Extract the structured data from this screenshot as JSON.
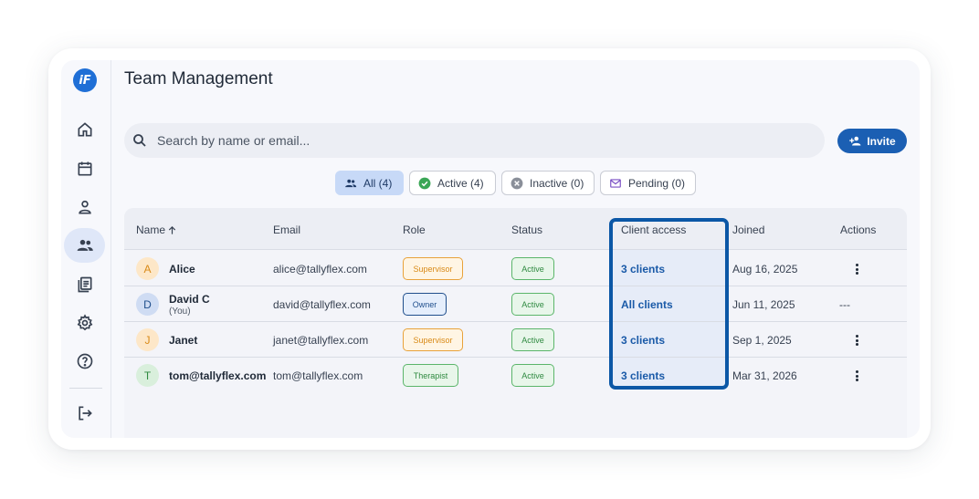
{
  "app": {
    "logo_text": "iF",
    "title": "Team Management"
  },
  "sidebar": {
    "items": [
      {
        "name": "home",
        "icon": "home-icon",
        "active": false
      },
      {
        "name": "calendar",
        "icon": "calendar-icon",
        "active": false
      },
      {
        "name": "person",
        "icon": "person-icon",
        "active": false
      },
      {
        "name": "team",
        "icon": "group-icon",
        "active": true
      },
      {
        "name": "notes",
        "icon": "notes-icon",
        "active": false
      },
      {
        "name": "settings",
        "icon": "gear-icon",
        "active": false
      },
      {
        "name": "help",
        "icon": "help-icon",
        "active": false
      },
      {
        "name": "logout",
        "icon": "logout-icon",
        "active": false
      }
    ]
  },
  "search": {
    "placeholder": "Search by name or email...",
    "value": ""
  },
  "invite": {
    "label": "Invite"
  },
  "filters": [
    {
      "label": "All (4)",
      "icon": "group-icon",
      "selected": true
    },
    {
      "label": "Active (4)",
      "icon": "check-circle-icon",
      "selected": false
    },
    {
      "label": "Inactive (0)",
      "icon": "x-circle-icon",
      "selected": false
    },
    {
      "label": "Pending (0)",
      "icon": "mail-icon",
      "selected": false
    }
  ],
  "table": {
    "headers": {
      "name": "Name",
      "email": "Email",
      "role": "Role",
      "status": "Status",
      "access": "Client access",
      "joined": "Joined",
      "actions": "Actions"
    },
    "rows": [
      {
        "initial": "A",
        "name": "Alice",
        "sub": "",
        "email": "alice@tallyflex.com",
        "role": "Supervisor",
        "status": "Active",
        "access": "3 clients",
        "joined": "Aug 16, 2025",
        "actions": ""
      },
      {
        "initial": "D",
        "name": "David C",
        "sub": "(You)",
        "email": "david@tallyflex.com",
        "role": "Owner",
        "status": "Active",
        "access": "All clients",
        "joined": "Jun 11, 2025",
        "actions": "---"
      },
      {
        "initial": "J",
        "name": "Janet",
        "sub": "",
        "email": "janet@tallyflex.com",
        "role": "Supervisor",
        "status": "Active",
        "access": "3 clients",
        "joined": "Sep 1, 2025",
        "actions": ""
      },
      {
        "initial": "T",
        "name": "tom@tallyflex.com",
        "sub": "",
        "email": "tom@tallyflex.com",
        "role": "Therapist",
        "status": "Active",
        "access": "3 clients",
        "joined": "Mar 31, 2026",
        "actions": ""
      }
    ]
  },
  "colors": {
    "accent": "#1b5fb3",
    "highlight_border": "#0b57a6",
    "supervisor": "#d98a17",
    "owner": "#1f4e8c",
    "therapist": "#2f8a40",
    "active": "#2f8a40"
  }
}
